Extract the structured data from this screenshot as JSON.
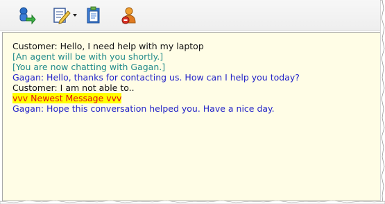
{
  "toolbar": {
    "buttons": [
      {
        "icon": "transfer-agent-icon"
      },
      {
        "icon": "edit-notes-icon"
      },
      {
        "icon": "clipboard-document-icon"
      },
      {
        "icon": "user-remove-icon"
      }
    ]
  },
  "chat": {
    "messages": [
      {
        "kind": "customer",
        "text": "Customer: Hello, I need help with my laptop"
      },
      {
        "kind": "system",
        "text": "[An agent will be with you shortly.]"
      },
      {
        "kind": "system",
        "text": "[You are now chatting with Gagan.]"
      },
      {
        "kind": "agent",
        "text": "Gagan: Hello, thanks for contacting us. How can I help you today?"
      },
      {
        "kind": "customer",
        "text": "Customer: I am not able to.."
      },
      {
        "kind": "marker",
        "text": "vvv   Newest Message   vvv"
      },
      {
        "kind": "agent",
        "text": "Gagan: Hope this conversation helped you. Have a nice day."
      }
    ]
  },
  "colors": {
    "chat_background": "#fffde6",
    "customer_text": "#111111",
    "system_text": "#208a8a",
    "agent_text": "#2323c8",
    "marker_text": "#e01010",
    "marker_highlight": "#ffff00"
  }
}
